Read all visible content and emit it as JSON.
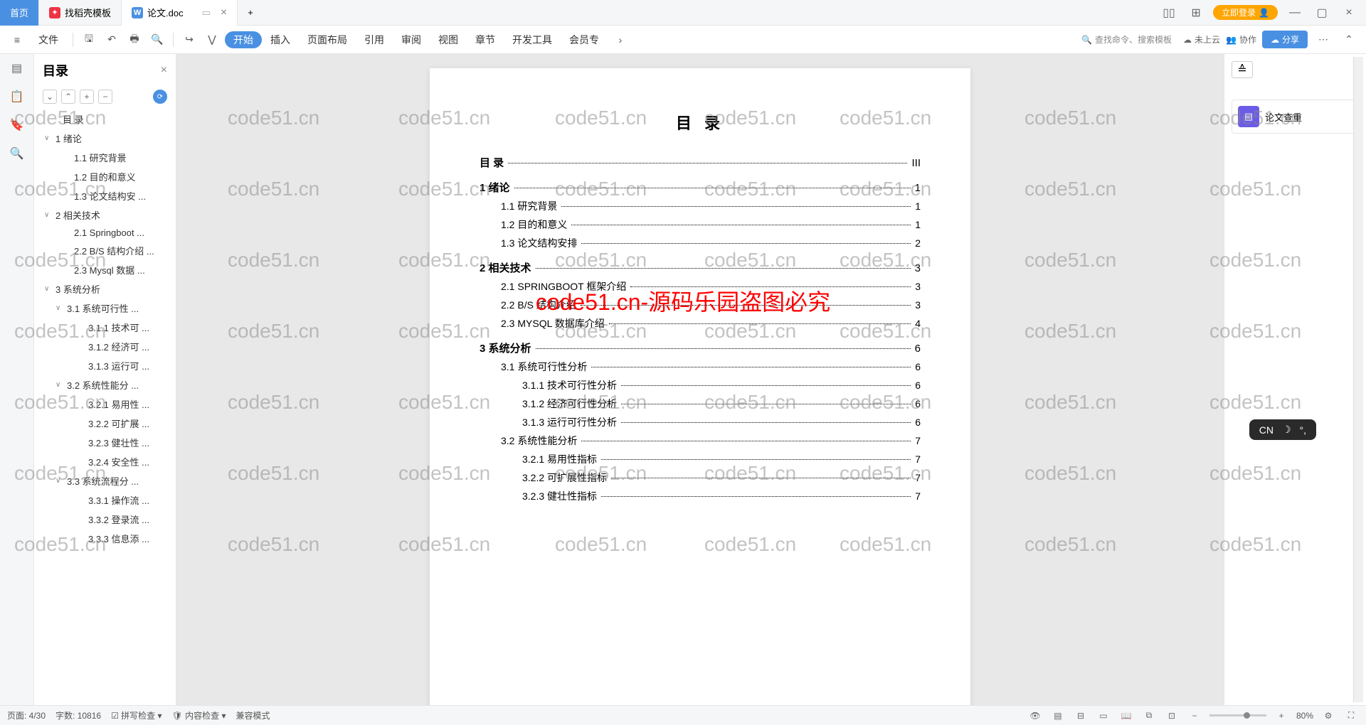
{
  "tabs": {
    "home": "首页",
    "t1": "找稻壳模板",
    "t2_icon": "W",
    "t2": "论文.doc"
  },
  "login_btn": "立即登录",
  "toolbar": {
    "file": "文件",
    "menus": [
      "开始",
      "插入",
      "页面布局",
      "引用",
      "审阅",
      "视图",
      "章节",
      "开发工具",
      "会员专"
    ],
    "search_placeholder": "查找命令、搜索模板",
    "cloud": "未上云",
    "collab": "协作",
    "share": "分享"
  },
  "sidebar": {
    "title": "目录",
    "items": [
      {
        "lvl": "l0",
        "text": "目 录",
        "chev": ""
      },
      {
        "lvl": "l1",
        "text": "1 绪论",
        "chev": "∨"
      },
      {
        "lvl": "l2",
        "text": "1.1 研究背景",
        "chev": ""
      },
      {
        "lvl": "l2",
        "text": "1.2 目的和意义",
        "chev": ""
      },
      {
        "lvl": "l2",
        "text": "1.3 论文结构安 ...",
        "chev": ""
      },
      {
        "lvl": "l1",
        "text": "2 相关技术",
        "chev": "∨"
      },
      {
        "lvl": "l2",
        "text": "2.1 Springboot ...",
        "chev": ""
      },
      {
        "lvl": "l2",
        "text": "2.2 B/S 结构介绍 ...",
        "chev": ""
      },
      {
        "lvl": "l2",
        "text": "2.3 Mysql 数据 ...",
        "chev": ""
      },
      {
        "lvl": "l1",
        "text": "3 系统分析",
        "chev": "∨"
      },
      {
        "lvl": "l3",
        "text": "3.1 系统可行性 ...",
        "chev": "∨"
      },
      {
        "lvl": "l4",
        "text": "3.1.1 技术可 ...",
        "chev": ""
      },
      {
        "lvl": "l4",
        "text": "3.1.2 经济可 ...",
        "chev": ""
      },
      {
        "lvl": "l4",
        "text": "3.1.3 运行可 ...",
        "chev": ""
      },
      {
        "lvl": "l3",
        "text": "3.2 系统性能分 ...",
        "chev": "∨"
      },
      {
        "lvl": "l4",
        "text": "3.2.1 易用性 ...",
        "chev": ""
      },
      {
        "lvl": "l4",
        "text": "3.2.2 可扩展 ...",
        "chev": ""
      },
      {
        "lvl": "l4",
        "text": "3.2.3 健壮性 ...",
        "chev": ""
      },
      {
        "lvl": "l4",
        "text": "3.2.4 安全性 ...",
        "chev": ""
      },
      {
        "lvl": "l3",
        "text": "3.3 系统流程分 ...",
        "chev": "∨"
      },
      {
        "lvl": "l4",
        "text": "3.3.1 操作流 ...",
        "chev": ""
      },
      {
        "lvl": "l4",
        "text": "3.3.2 登录流 ...",
        "chev": ""
      },
      {
        "lvl": "l4",
        "text": "3.3.3 信息添 ...",
        "chev": ""
      }
    ]
  },
  "doc": {
    "title": "目 录",
    "toc": [
      {
        "lvl": "h1",
        "label": "目 录",
        "page": "III"
      },
      {
        "lvl": "h1",
        "label": "1  绪论",
        "page": "1"
      },
      {
        "lvl": "h2",
        "label": "1.1  研究背景",
        "page": "1"
      },
      {
        "lvl": "h2",
        "label": "1.2  目的和意义",
        "page": "1"
      },
      {
        "lvl": "h2",
        "label": "1.3  论文结构安排",
        "page": "2"
      },
      {
        "lvl": "h1",
        "label": "2  相关技术",
        "page": "3"
      },
      {
        "lvl": "h2",
        "label": "2.1  SPRINGBOOT 框架介绍",
        "page": "3"
      },
      {
        "lvl": "h2",
        "label": "2.2  B/S 结构介绍",
        "page": "3"
      },
      {
        "lvl": "h2",
        "label": "2.3  MYSQL 数据库介绍",
        "page": "4"
      },
      {
        "lvl": "h1",
        "label": "3  系统分析",
        "page": "6"
      },
      {
        "lvl": "h2",
        "label": "3.1  系统可行性分析",
        "page": "6"
      },
      {
        "lvl": "h3",
        "label": "3.1.1  技术可行性分析",
        "page": "6"
      },
      {
        "lvl": "h3",
        "label": "3.1.2  经济可行性分析",
        "page": "6"
      },
      {
        "lvl": "h3",
        "label": "3.1.3  运行可行性分析",
        "page": "6"
      },
      {
        "lvl": "h2",
        "label": "3.2  系统性能分析",
        "page": "7"
      },
      {
        "lvl": "h3",
        "label": "3.2.1  易用性指标",
        "page": "7"
      },
      {
        "lvl": "h3",
        "label": "3.2.2  可扩展性指标",
        "page": "7"
      },
      {
        "lvl": "h3",
        "label": "3.2.3  健壮性指标",
        "page": "7"
      }
    ]
  },
  "rightpanel": {
    "check": "论文查重"
  },
  "statusbar": {
    "page": "页面: 4/30",
    "words": "字数: 10816",
    "spell": "拼写检查",
    "content": "内容检查",
    "compat": "兼容模式",
    "zoom": "80%"
  },
  "watermark": "code51.cn",
  "banner": "code51.cn-源码乐园盗图必究",
  "ime": "CN"
}
